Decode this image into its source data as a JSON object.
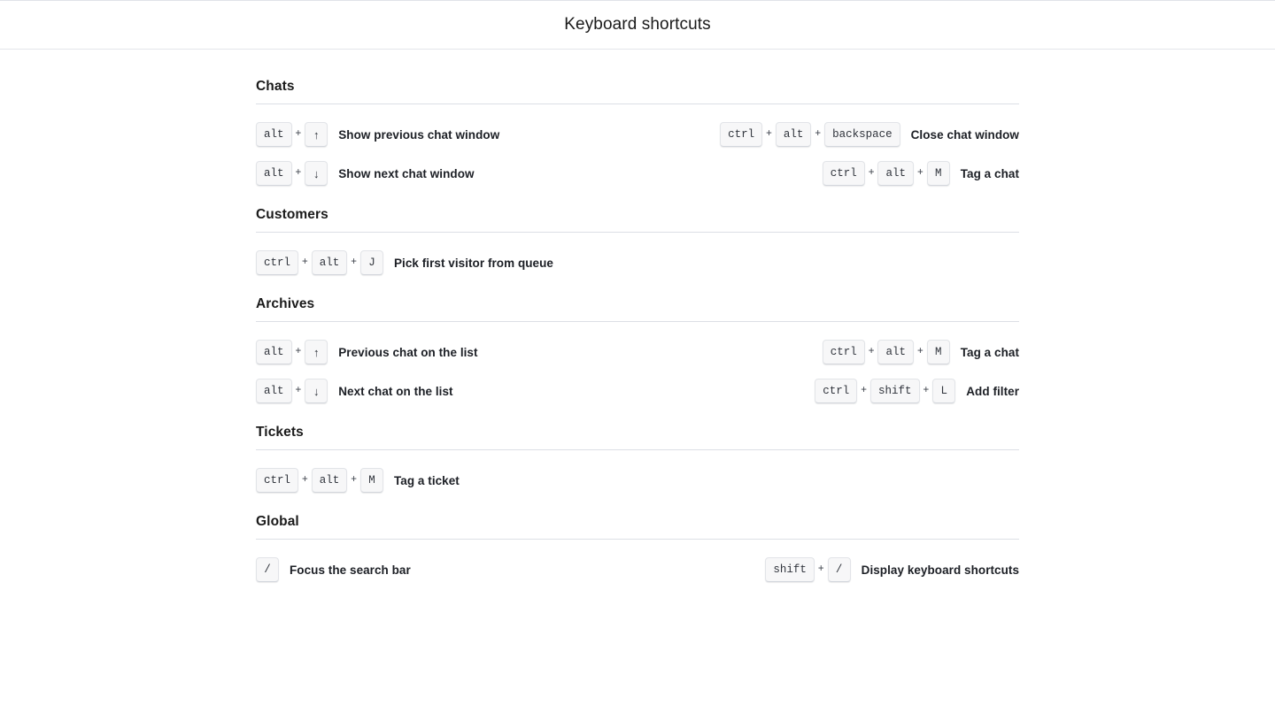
{
  "header": {
    "title": "Keyboard shortcuts"
  },
  "plus_symbol": "+",
  "sections": [
    {
      "name": "Chats",
      "title": "Chats",
      "rows": [
        {
          "left": {
            "keys": [
              "alt",
              "↑"
            ],
            "label": "Show previous chat window"
          },
          "right": {
            "keys": [
              "ctrl",
              "alt",
              "backspace"
            ],
            "label": "Close chat window"
          }
        },
        {
          "left": {
            "keys": [
              "alt",
              "↓"
            ],
            "label": "Show next chat window"
          },
          "right": {
            "keys": [
              "ctrl",
              "alt",
              "M"
            ],
            "label": "Tag a chat"
          }
        }
      ]
    },
    {
      "name": "Customers",
      "title": "Customers",
      "rows": [
        {
          "left": {
            "keys": [
              "ctrl",
              "alt",
              "J"
            ],
            "label": "Pick first visitor from queue"
          },
          "right": null
        }
      ]
    },
    {
      "name": "Archives",
      "title": "Archives",
      "rows": [
        {
          "left": {
            "keys": [
              "alt",
              "↑"
            ],
            "label": "Previous chat on the list"
          },
          "right": {
            "keys": [
              "ctrl",
              "alt",
              "M"
            ],
            "label": "Tag a chat"
          }
        },
        {
          "left": {
            "keys": [
              "alt",
              "↓"
            ],
            "label": "Next chat on the list"
          },
          "right": {
            "keys": [
              "ctrl",
              "shift",
              "L"
            ],
            "label": "Add filter"
          }
        }
      ]
    },
    {
      "name": "Tickets",
      "title": "Tickets",
      "rows": [
        {
          "left": {
            "keys": [
              "ctrl",
              "alt",
              "M"
            ],
            "label": "Tag a ticket"
          },
          "right": null
        }
      ]
    },
    {
      "name": "Global",
      "title": "Global",
      "rows": [
        {
          "left": {
            "keys": [
              "/"
            ],
            "label": "Focus the search bar"
          },
          "right": {
            "keys": [
              "shift",
              "/"
            ],
            "label": "Display keyboard shortcuts"
          }
        }
      ]
    }
  ],
  "colors": {
    "page_background": "#ffffff",
    "key_background": "#f7f7f8",
    "key_border": "#e2e4e8",
    "divider": "#dcdfe5",
    "text": "#1a1a1a"
  }
}
